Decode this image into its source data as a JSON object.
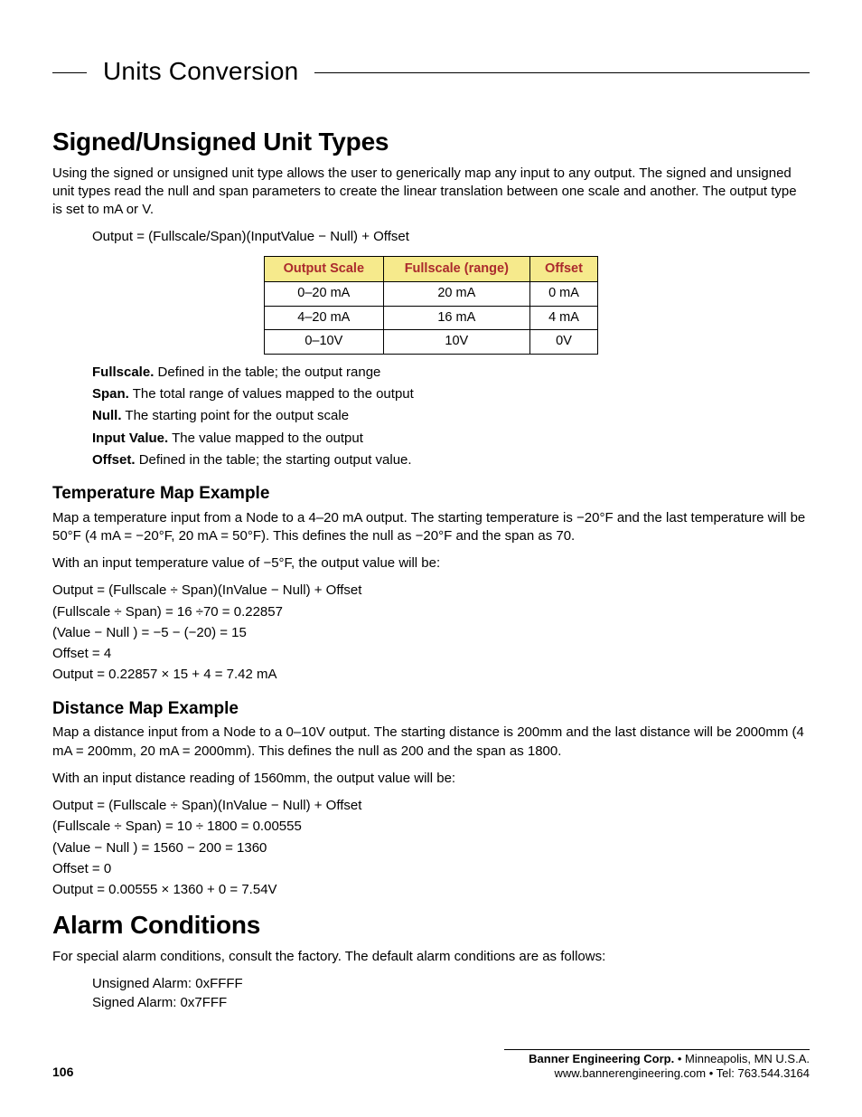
{
  "header": {
    "title": "Units Conversion"
  },
  "signed": {
    "title": "Signed/Unsigned Unit Types",
    "intro": "Using the signed or unsigned unit type allows the user to generically map any input to any output. The signed and unsigned unit types read the null and span parameters to create the linear translation between one scale and another. The output type is set to mA or V.",
    "formula": "Output = (Fullscale/Span)(InputValue − Null) + Offset",
    "table": {
      "headers": [
        "Output Scale",
        "Fullscale (range)",
        "Offset"
      ],
      "rows": [
        [
          "0–20 mA",
          "20 mA",
          "0 mA"
        ],
        [
          "4–20 mA",
          "16 mA",
          "4 mA"
        ],
        [
          "0–10V",
          "10V",
          "0V"
        ]
      ]
    },
    "defs": {
      "fullscale": {
        "label": "Fullscale.",
        "text": "Defined in the table; the output range"
      },
      "span": {
        "label": "Span.",
        "text": "The total range of values mapped to the output"
      },
      "null": {
        "label": "Null.",
        "text": "The starting point for the output scale"
      },
      "input": {
        "label": "Input Value.",
        "text": "The value mapped to the output"
      },
      "offset": {
        "label": "Offset.",
        "text": "Defined in the table; the starting output value."
      }
    }
  },
  "temp": {
    "title": "Temperature Map Example",
    "p1": "Map a temperature input from a Node to a 4–20 mA output. The starting temperature is −20°F and the last temperature will be 50°F (4 mA = −20°F, 20 mA = 50°F). This defines the null as −20°F and the span as 70.",
    "p2": "With an input temperature value of −5°F, the output value will be:",
    "calc": {
      "l1": "Output = (Fullscale ÷ Span)(InValue − Null) + Offset",
      "l2": "(Fullscale ÷ Span) = 16 ÷70  = 0.22857",
      "l3": "(Value − Null ) = −5 − (−20) = 15",
      "l4": "Offset = 4",
      "l5": "Output = 0.22857 × 15 + 4 = 7.42 mA"
    }
  },
  "dist": {
    "title": "Distance Map Example",
    "p1": "Map a distance input from a Node to a 0–10V output. The starting distance is 200mm and the last distance will be 2000mm (4 mA = 200mm, 20 mA = 2000mm). This defines the null as 200 and the span as 1800.",
    "p2": "With an input distance reading of 1560mm, the output value will be:",
    "calc": {
      "l1": "Output = (Fullscale ÷ Span)(InValue − Null) + Offset",
      "l2": "(Fullscale ÷ Span) = 10 ÷ 1800 = 0.00555",
      "l3": "(Value − Null ) = 1560 − 200  = 1360",
      "l4": "Offset = 0",
      "l5": "Output = 0.00555 × 1360 + 0 = 7.54V"
    }
  },
  "alarm": {
    "title": "Alarm Conditions",
    "p1": "For special alarm conditions, consult the factory. The default alarm conditions are as follows:",
    "l1": "Unsigned Alarm: 0xFFFF",
    "l2": "Signed Alarm: 0x7FFF"
  },
  "footer": {
    "page": "106",
    "company_bold": "Banner Engineering Corp.",
    "company_rest": " • Minneapolis, MN U.S.A.",
    "contact": "www.bannerengineering.com  •  Tel: 763.544.3164"
  }
}
